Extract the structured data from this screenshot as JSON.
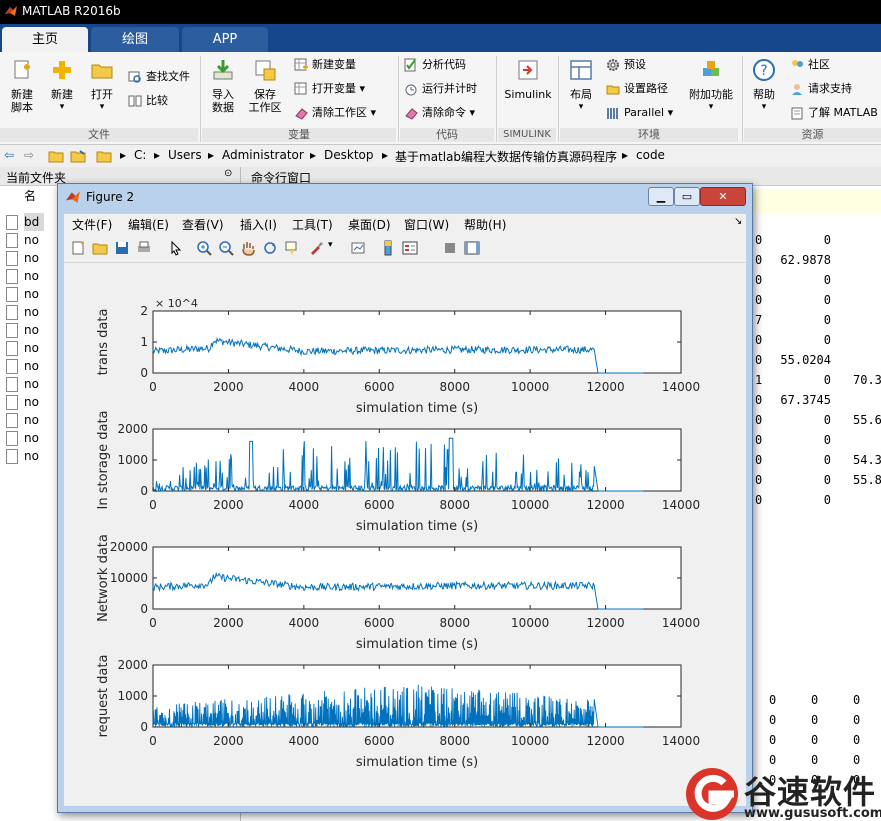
{
  "app": {
    "title": "MATLAB R2016b"
  },
  "tabs": [
    {
      "label": "主页"
    },
    {
      "label": "绘图"
    },
    {
      "label": "APP"
    }
  ],
  "ribbon": {
    "new_script": "新建\n脚本",
    "new": "新建",
    "open": "打开",
    "find_files": "查找文件",
    "compare": "比较",
    "import_data": "导入\n数据",
    "save_workspace": "保存\n工作区",
    "new_variable": "新建变量",
    "open_variable": "打开变量",
    "clear_workspace": "清除工作区",
    "analyze_code": "分析代码",
    "run_and_time": "运行并计时",
    "clear_commands": "清除命令",
    "simulink": "Simulink",
    "layout": "布局",
    "preferences": "预设",
    "set_path": "设置路径",
    "parallel": "Parallel",
    "addons": "附加功能",
    "help": "帮助",
    "community": "社区",
    "request_support": "请求支持",
    "learn_matlab": "了解 MATLAB",
    "groups": [
      "文件",
      "变量",
      "代码",
      "SIMULINK",
      "环境",
      "资源"
    ]
  },
  "address": {
    "crumbs": [
      "C:",
      "Users",
      "Administrator",
      "Desktop",
      "基于matlab编程大数据传输仿真源码程序",
      "code"
    ]
  },
  "left_panel": {
    "title": "当前文件夹",
    "col": "名",
    "files": [
      "bd",
      "no",
      "no",
      "no",
      "no",
      "no",
      "no",
      "no",
      "no",
      "no",
      "no",
      "no",
      "no",
      "no"
    ]
  },
  "command_window": {
    "title": "命令行窗口",
    "rows": [
      [
        "0",
        "0",
        ""
      ],
      [
        "0",
        "62.9878",
        ""
      ],
      [
        "0",
        "0",
        ""
      ],
      [
        "0",
        "0",
        ""
      ],
      [
        "7",
        "0",
        ""
      ],
      [
        "0",
        "0",
        ""
      ],
      [
        "0",
        "55.0204",
        ""
      ],
      [
        "1",
        "0",
        "70.3"
      ],
      [
        "0",
        "67.3745",
        ""
      ],
      [
        "0",
        "0",
        "55.6"
      ],
      [
        "0",
        "0",
        ""
      ],
      [
        "0",
        "0",
        "54.3"
      ],
      [
        "0",
        "0",
        "55.8"
      ],
      [
        "0",
        "0",
        ""
      ]
    ],
    "lower_rows": [
      [
        "0",
        "0",
        "0"
      ],
      [
        "0",
        "0",
        "0"
      ],
      [
        "0",
        "0",
        "0"
      ],
      [
        "0",
        "0",
        "0"
      ],
      [
        "0",
        "0",
        "0"
      ]
    ]
  },
  "figure": {
    "title": "Figure 2",
    "menu": [
      "文件(F)",
      "编辑(E)",
      "查看(V)",
      "插入(I)",
      "工具(T)",
      "桌面(D)",
      "窗口(W)",
      "帮助(H)"
    ]
  },
  "chart_data": [
    {
      "type": "line",
      "ylabel": "trans data",
      "xlabel": "simulation time (s)",
      "xlim": [
        0,
        14000
      ],
      "ylim": [
        0,
        20000
      ],
      "yticks": [
        "0",
        "1",
        "2"
      ],
      "exponent": "× 10^4",
      "xticks": [
        "0",
        "2000",
        "4000",
        "6000",
        "8000",
        "10000",
        "12000",
        "14000"
      ],
      "series": [
        {
          "x": [
            0,
            1500,
            1600,
            4000,
            8000,
            11700,
            11800,
            13000
          ],
          "y": [
            7000,
            8000,
            10500,
            7000,
            7500,
            7500,
            0,
            0
          ]
        }
      ]
    },
    {
      "type": "line",
      "ylabel": "In storage data",
      "xlabel": "simulation time (s)",
      "xlim": [
        0,
        14000
      ],
      "ylim": [
        0,
        2000
      ],
      "yticks": [
        "0",
        "1000",
        "2000"
      ],
      "xticks": [
        "0",
        "2000",
        "4000",
        "6000",
        "8000",
        "10000",
        "12000",
        "14000"
      ],
      "series": [
        {
          "x": [
            0,
            2600,
            7900,
            11700,
            11800,
            13000
          ],
          "y": [
            200,
            1600,
            1700,
            800,
            0,
            0
          ]
        }
      ]
    },
    {
      "type": "line",
      "ylabel": "Network data",
      "xlabel": "simulation time (s)",
      "xlim": [
        0,
        14000
      ],
      "ylim": [
        0,
        20000
      ],
      "yticks": [
        "0",
        "10000",
        "20000"
      ],
      "xticks": [
        "0",
        "2000",
        "4000",
        "6000",
        "8000",
        "10000",
        "12000",
        "14000"
      ],
      "series": [
        {
          "x": [
            0,
            1500,
            1600,
            4000,
            8000,
            11700,
            11800,
            13000
          ],
          "y": [
            7000,
            8000,
            10500,
            7000,
            7500,
            7500,
            0,
            0
          ]
        }
      ]
    },
    {
      "type": "line",
      "ylabel": "request data",
      "xlabel": "simulation time (s)",
      "xlim": [
        0,
        14000
      ],
      "ylim": [
        0,
        2000
      ],
      "yticks": [
        "0",
        "1000",
        "2000"
      ],
      "xticks": [
        "0",
        "2000",
        "4000",
        "6000",
        "8000",
        "10000",
        "12000",
        "14000"
      ],
      "series": [
        {
          "x": [
            0,
            6900,
            11700,
            11800,
            13000
          ],
          "y": [
            700,
            1400,
            900,
            0,
            0
          ]
        }
      ]
    }
  ],
  "watermark": {
    "text": "谷速软件",
    "url": "www.gususoft.com"
  }
}
